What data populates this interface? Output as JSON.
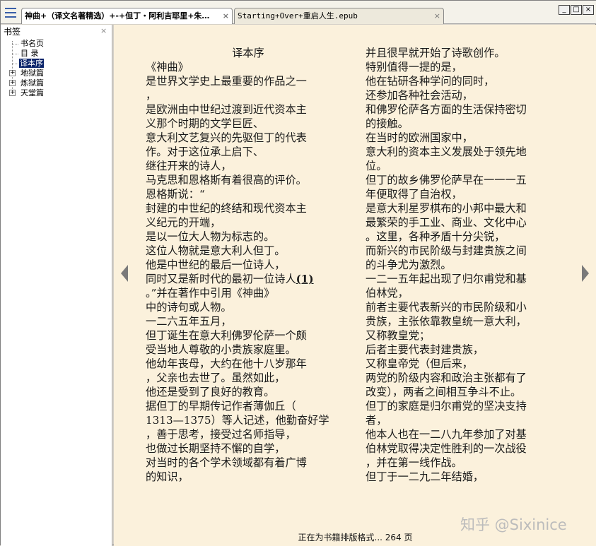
{
  "tabs": [
    {
      "label": "神曲+（译文名著精选）+-+但丁・阿利吉耶里+朱…",
      "close": "×",
      "active": true
    },
    {
      "label": "Starting+Over+重启人生.epub",
      "close": "×",
      "active": false
    }
  ],
  "window_controls": {
    "minimize": "_",
    "maximize": "□",
    "close": "×"
  },
  "sidebar": {
    "title": "书签",
    "close": "×",
    "items": [
      {
        "label": "书名页",
        "expander": ""
      },
      {
        "label": "目 录",
        "expander": ""
      },
      {
        "label": "译本序",
        "expander": "",
        "selected": true
      },
      {
        "label": "地狱篇",
        "expander": "+"
      },
      {
        "label": "炼狱篇",
        "expander": "+"
      },
      {
        "label": "天堂篇",
        "expander": "+"
      }
    ]
  },
  "content": {
    "left_column": [
      "译本序",
      "《神曲》",
      "是世界文学史上最重要的作品之一",
      "，",
      "是欧洲由中世纪过渡到近代资本主",
      "义那个时期的文学巨匠、",
      "意大利文艺复兴的先驱但丁的代表",
      "作。对于这位承上启下、",
      "继往开来的诗人，",
      "马克思和恩格斯有着很高的评价。",
      "恩格斯说：“",
      "封建的中世纪的终结和现代资本主",
      "义纪元的开端，",
      "是以一位大人物为标志的。",
      "这位人物就是意大利人但丁。",
      "他是中世纪的最后一位诗人，",
      "同时又是新时代的最初一位诗人",
      "。”并在著作中引用《神曲》",
      "中的诗句或人物。",
      "一二六五年五月，",
      "但丁诞生在意大利佛罗伦萨一个颇",
      "受当地人尊敬的小贵族家庭里。",
      "他幼年丧母，大约在他十八岁那年",
      "，父亲也去世了。虽然如此，",
      "他还是受到了良好的教育。",
      "据但丁的早期传记作者薄伽丘（",
      "1313—1375）等人记述，他勤奋好学",
      "，善于思考，接受过名师指导，",
      "也做过长期坚持不懈的自学，",
      "对当时的各个学术领域都有着广博",
      "的知识，"
    ],
    "footnote_ref": "(1)",
    "right_column": [
      "并且很早就开始了诗歌创作。",
      "特别值得一提的是，",
      "他在钻研各种学问的同时，",
      "还参加各种社会活动，",
      "和佛罗伦萨各方面的生活保持密切",
      "的接触。",
      "在当时的欧洲国家中，",
      "意大利的资本主义发展处于领先地",
      "位。",
      "但丁的故乡佛罗伦萨早在一一一五",
      "年便取得了自治权，",
      "是意大利星罗棋布的小邦中最大和",
      "最繁荣的手工业、商业、文化中心",
      "。这里，各种矛盾十分尖锐，",
      "而新兴的市民阶级与封建贵族之间",
      "的斗争尤为激烈。",
      "一二一五年起出现了归尔甫党和基",
      "伯林党，",
      "前者主要代表新兴的市民阶级和小",
      "贵族，主张依靠教皇统一意大利，",
      "又称教皇党；",
      "后者主要代表封建贵族，",
      "又称皇帝党（但后来，",
      "两党的阶级内容和政治主张都有了",
      "改变），两者之间相互争斗不止。",
      "但丁的家庭是归尔甫党的坚决支持",
      "者，",
      "他本人也在一二八九年参加了对基",
      "伯林党取得决定性胜利的一次战役",
      "，并在第一线作战。",
      "但丁于一二九二年结婚，"
    ]
  },
  "status": "正在为书籍排版格式... 264 页",
  "watermark": "知乎 @Sixinice"
}
